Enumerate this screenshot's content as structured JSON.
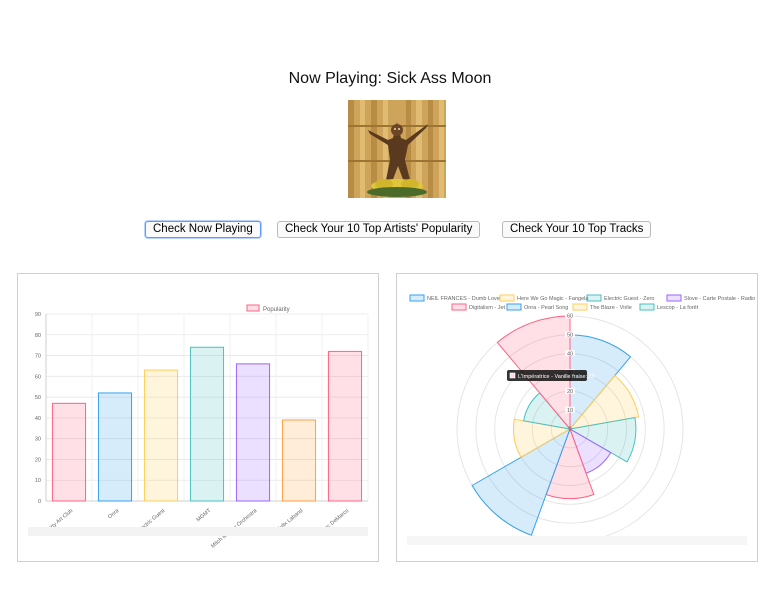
{
  "now_playing": {
    "title": "Now Playing: Sick Ass Moon"
  },
  "buttons": {
    "now_playing": "Check Now Playing",
    "artists": "Check Your 10 Top Artists' Popularity",
    "tracks": "Check Your 10 Top Tracks"
  },
  "chart_data": [
    {
      "type": "bar",
      "categories": [
        "Dirty Art Club",
        "Onra",
        "Electric Guest",
        "MGMT",
        "Mitch Murder Orchestra",
        "Fellx Laband",
        "Mac DeMarco"
      ],
      "series": [
        {
          "name": "Popularity",
          "values": [
            47,
            52,
            63,
            74,
            66,
            39,
            72
          ]
        }
      ],
      "ylim": [
        0,
        90
      ],
      "yticks": [
        0,
        10,
        20,
        30,
        40,
        50,
        60,
        70,
        80,
        90
      ],
      "grid": true,
      "legend": "top",
      "colors": {
        "fill": [
          "rgba(255,99,132,0.2)",
          "rgba(54,162,235,0.2)",
          "rgba(255,206,86,0.2)",
          "rgba(75,192,192,0.2)",
          "rgba(153,102,255,0.2)",
          "rgba(255,159,64,0.2)",
          "rgba(255,99,132,0.2)"
        ],
        "stroke": [
          "#ff6384",
          "#36a2eb",
          "#ffce56",
          "#4bc0c0",
          "#9966ff",
          "#ff9f40",
          "#ff6384"
        ]
      }
    },
    {
      "type": "polarArea",
      "labels": [
        "NEIL FRANCES - Dumb Love",
        "Here We Go Magic - Fangela",
        "Electric Guest - Zero",
        "Slove - Carte Postale - Radio Edit",
        "Digitalism - Jet",
        "Onra - Pearl Song",
        "The Blaze - Virile",
        "Lescop - La forêt",
        "L'Impératrice - Vanille fraise"
      ],
      "values": [
        50,
        37,
        35,
        25,
        37,
        60,
        30,
        25,
        60
      ],
      "rlim": [
        0,
        60
      ],
      "rticks": [
        0,
        10,
        20,
        30,
        40,
        50,
        60
      ],
      "legend": "top",
      "tooltip": "L'Impératrice - Vanille fraise: 60",
      "colors": {
        "fill": [
          "rgba(54,162,235,0.2)",
          "rgba(255,206,86,0.2)",
          "rgba(75,192,192,0.2)",
          "rgba(153,102,255,0.2)",
          "rgba(255,99,132,0.2)",
          "rgba(54,162,235,0.2)",
          "rgba(255,206,86,0.2)",
          "rgba(75,192,192,0.2)",
          "rgba(255,99,132,0.2)"
        ],
        "stroke": [
          "#36a2eb",
          "#ffce56",
          "#4bc0c0",
          "#9966ff",
          "#ff6384",
          "#36a2eb",
          "#ffce56",
          "#4bc0c0",
          "#ff6384"
        ]
      }
    }
  ]
}
